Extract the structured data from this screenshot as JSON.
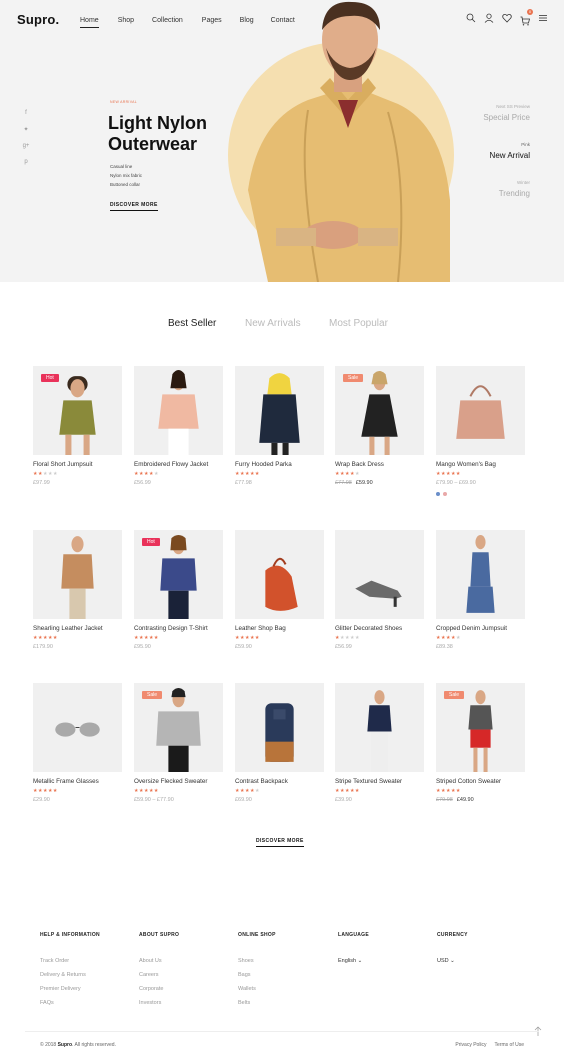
{
  "brand": "Supro.",
  "nav": [
    "Home",
    "Shop",
    "Collection",
    "Pages",
    "Blog",
    "Contact"
  ],
  "cart_count": "0",
  "hero": {
    "eyebrow": "NEW ARRIVAL",
    "title": "Light Nylon Outerwear",
    "features": [
      "Casual line",
      "Nylon mix fabric",
      "Buttoned collar"
    ],
    "cta": "DISCOVER MORE",
    "circle_color": "#f5dfb0"
  },
  "slides": [
    {
      "top": "Next SS Preview",
      "main": "Special Price",
      "active": false
    },
    {
      "top": "Pink",
      "main": "New Arrival",
      "active": true
    },
    {
      "top": "Winter",
      "main": "Trending",
      "active": false
    }
  ],
  "tabs": [
    "Best Seller",
    "New Arrivals",
    "Most Popular"
  ],
  "products": [
    {
      "name": "Floral Short Jumpsuit",
      "rating": 2,
      "price": "£97.99",
      "badge": "Hot"
    },
    {
      "name": "Embroidered Flowy Jacket",
      "rating": 4,
      "price": "£56.99"
    },
    {
      "name": "Furry Hooded Parka",
      "rating": 5,
      "price": "£77.98"
    },
    {
      "name": "Wrap Back Dress",
      "rating": 4,
      "old_price": "£77.98",
      "price": "£59.90",
      "badge": "Sale"
    },
    {
      "name": "Mango Women's Bag",
      "rating": 5,
      "price": "£79.90 – £69.90",
      "swatches": [
        "#6a8ec9",
        "#e9a8a8"
      ]
    },
    {
      "name": "Shearling Leather Jacket",
      "rating": 5,
      "price": "£179.90"
    },
    {
      "name": "Contrasting Design T-Shirt",
      "rating": 5,
      "price": "£95.90",
      "badge": "Hot"
    },
    {
      "name": "Leather Shop Bag",
      "rating": 5,
      "price": "£59.90"
    },
    {
      "name": "Glitter Decorated Shoes",
      "rating": 1,
      "price": "£56.99"
    },
    {
      "name": "Cropped Denim Jumpsuit",
      "rating": 4,
      "price": "£89.38"
    },
    {
      "name": "Metallic Frame Glasses",
      "rating": 5,
      "price": "£29.90"
    },
    {
      "name": "Oversize Flecked Sweater",
      "rating": 5,
      "price": "£59.90 – £77.90",
      "badge": "Sale"
    },
    {
      "name": "Contrast Backpack",
      "rating": 4,
      "price": "£69.90"
    },
    {
      "name": "Stripe Textured Sweater",
      "rating": 5,
      "price": "£39.90"
    },
    {
      "name": "Striped Cotton Sweater",
      "rating": 5,
      "old_price": "£79.98",
      "price": "£49.90",
      "badge": "Sale"
    }
  ],
  "discover_more": "DISCOVER MORE",
  "footer": {
    "columns": [
      {
        "title": "HELP & INFORMATION",
        "links": [
          "Track Order",
          "Delivery & Returns",
          "Premier Delivery",
          "FAQs"
        ]
      },
      {
        "title": "ABOUT SUPRO",
        "links": [
          "About Us",
          "Careers",
          "Corporate",
          "Investors"
        ]
      },
      {
        "title": "ONLINE SHOP",
        "links": [
          "Shoes",
          "Bags",
          "Wallets",
          "Belts"
        ]
      },
      {
        "title": "LANGUAGE",
        "select": "English"
      },
      {
        "title": "CURRENCY",
        "select": "USD"
      }
    ],
    "copyright_prefix": "© 2018",
    "copyright_brand": "Supro",
    "copyright_suffix": ". All rights reserved.",
    "links": [
      "Privacy Policy",
      "Terms of Use"
    ]
  },
  "colors": {
    "accent": "#e9734f",
    "hot": "#e9325a",
    "sale": "#f08a6f"
  }
}
